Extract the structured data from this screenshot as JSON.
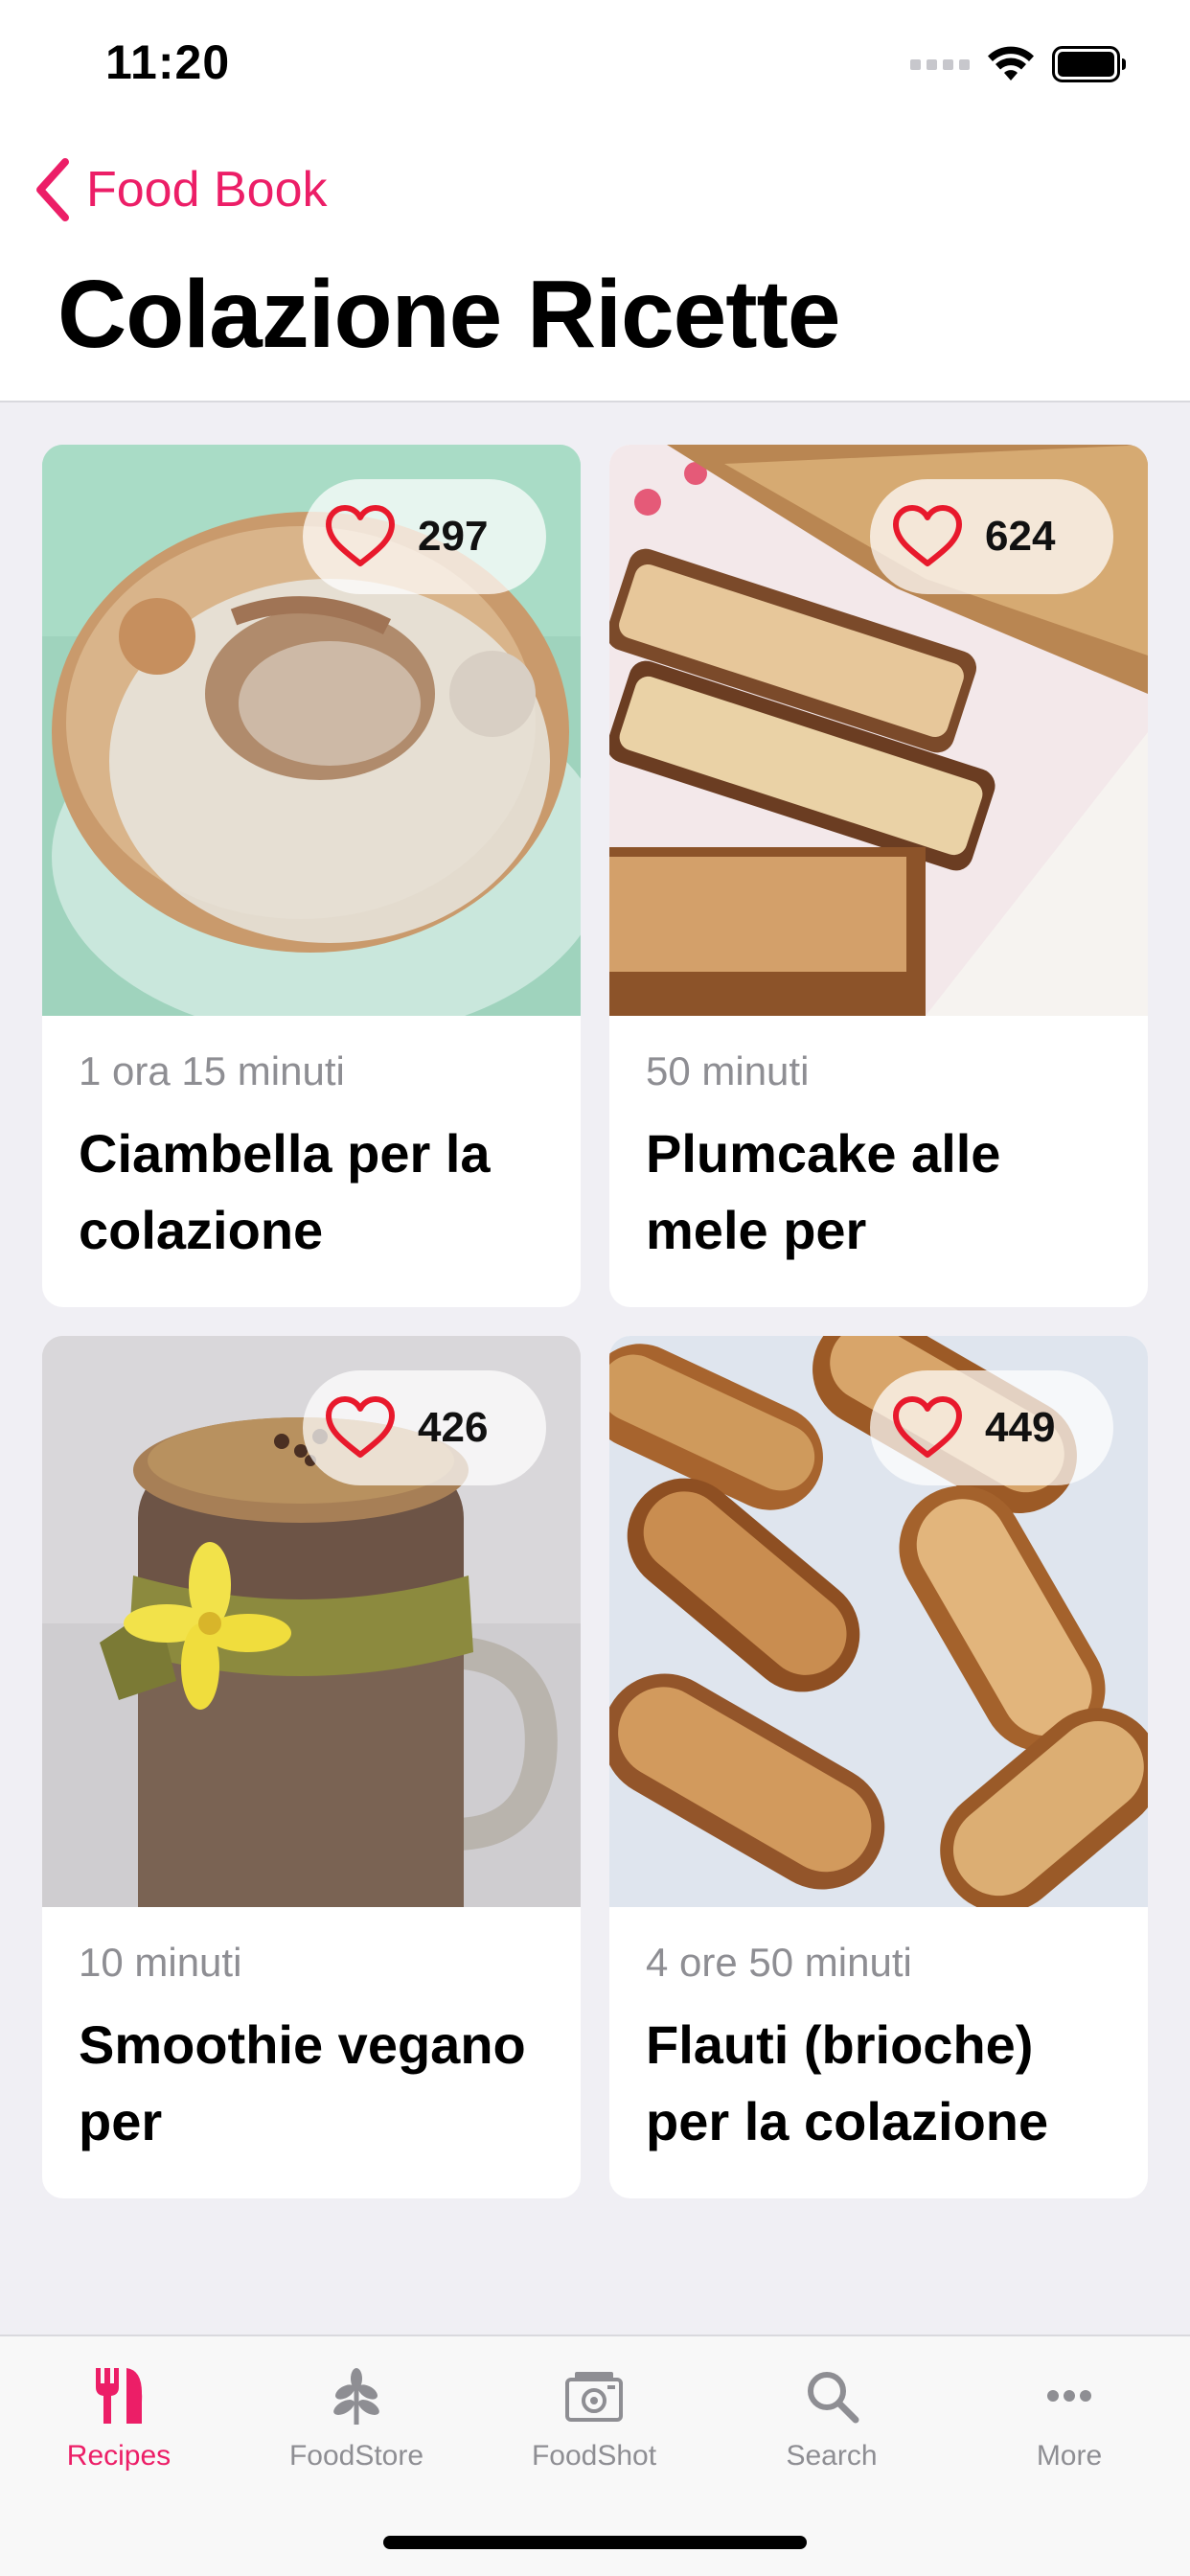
{
  "status_bar": {
    "time": "11:20"
  },
  "nav": {
    "back_label": "Food Book",
    "title": "Colazione Ricette"
  },
  "colors": {
    "accent": "#ec1e67",
    "heart": "#e8192c",
    "inactive": "#8e8e93"
  },
  "recipes": [
    {
      "likes": "297",
      "time": "1 ora 15 minuti",
      "title": "Ciambella per la colazione",
      "image": "ring-cake-photo"
    },
    {
      "likes": "624",
      "time": "50 minuti",
      "title": "Plumcake alle mele per",
      "image": "apple-plumcake-photo"
    },
    {
      "likes": "426",
      "time": "10 minuti",
      "title": "Smoothie vegano per",
      "image": "smoothie-jar-photo"
    },
    {
      "likes": "449",
      "time": "4 ore 50 minuti",
      "title": "Flauti (brioche) per la colazione",
      "image": "brioche-flauti-photo"
    }
  ],
  "tabbar": {
    "tabs": [
      {
        "label": "Recipes",
        "icon": "fork-knife-icon",
        "active": true
      },
      {
        "label": "FoodStore",
        "icon": "sprout-icon",
        "active": false
      },
      {
        "label": "FoodShot",
        "icon": "camera-icon",
        "active": false
      },
      {
        "label": "Search",
        "icon": "search-icon",
        "active": false
      },
      {
        "label": "More",
        "icon": "more-icon",
        "active": false
      }
    ]
  }
}
